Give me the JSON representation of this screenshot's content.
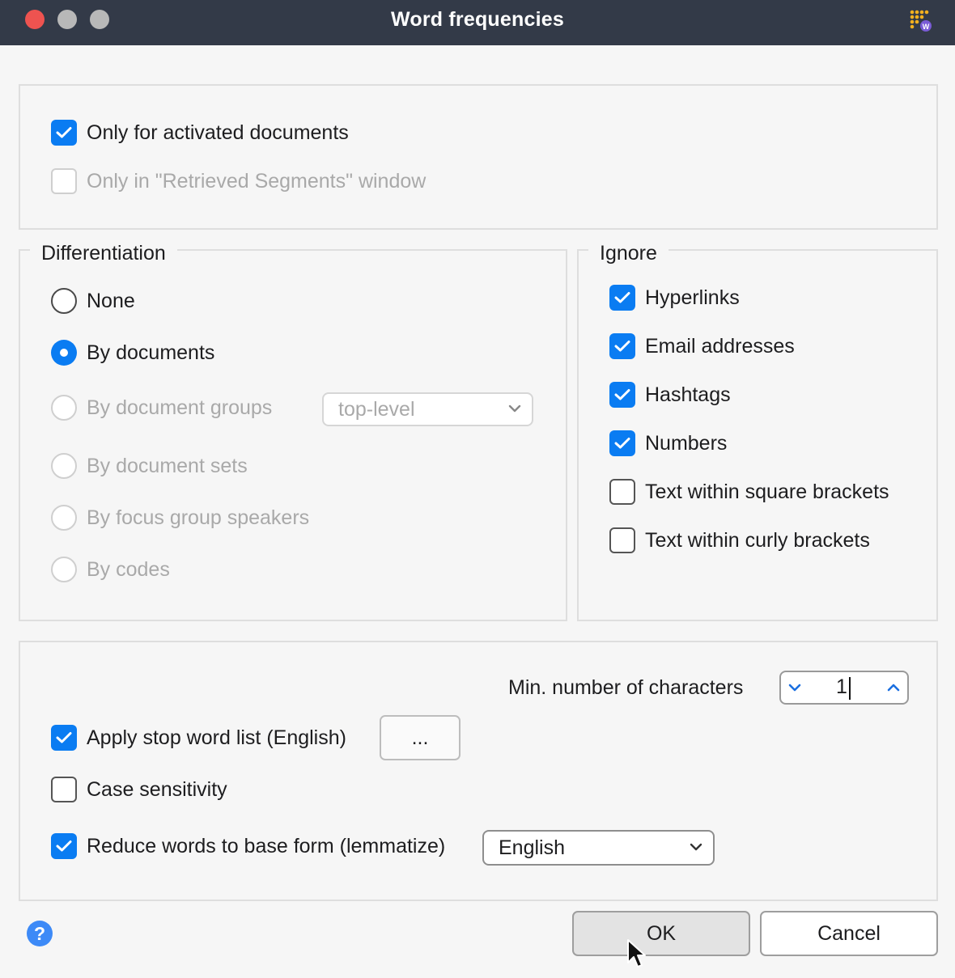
{
  "window": {
    "title": "Word frequencies",
    "app_icon": "maxqda-word-frequency-icon"
  },
  "scope": {
    "activated_documents": {
      "label": "Only for activated documents",
      "checked": true
    },
    "retrieved_segments": {
      "label": "Only in \"Retrieved Segments\" window",
      "checked": false,
      "disabled": true
    }
  },
  "differentiation": {
    "legend": "Differentiation",
    "options": [
      {
        "label": "None",
        "selected": false,
        "disabled": false
      },
      {
        "label": "By documents",
        "selected": true,
        "disabled": false
      },
      {
        "label": "By document groups",
        "selected": false,
        "disabled": true
      },
      {
        "label": "By document sets",
        "selected": false,
        "disabled": true
      },
      {
        "label": "By focus group speakers",
        "selected": false,
        "disabled": true
      },
      {
        "label": "By codes",
        "selected": false,
        "disabled": true
      }
    ],
    "group_level": {
      "value": "top-level",
      "disabled": true
    }
  },
  "ignore": {
    "legend": "Ignore",
    "items": [
      {
        "label": "Hyperlinks",
        "checked": true
      },
      {
        "label": "Email addresses",
        "checked": true
      },
      {
        "label": "Hashtags",
        "checked": true
      },
      {
        "label": "Numbers",
        "checked": true
      },
      {
        "label": "Text within square brackets",
        "checked": false
      },
      {
        "label": "Text within curly brackets",
        "checked": false
      }
    ]
  },
  "options": {
    "min_chars": {
      "label": "Min. number of characters",
      "value": "1"
    },
    "stop_words": {
      "label": "Apply stop word list (English)",
      "checked": true,
      "button": "..."
    },
    "case_sensitivity": {
      "label": "Case sensitivity",
      "checked": false
    },
    "lemmatize": {
      "label": "Reduce words to base form (lemmatize)",
      "checked": true,
      "language": "English"
    }
  },
  "footer": {
    "ok": "OK",
    "cancel": "Cancel",
    "help_icon": "?"
  },
  "colors": {
    "accent": "#0a7cf2",
    "titlebar": "#333a48",
    "help": "#3d8af7"
  }
}
